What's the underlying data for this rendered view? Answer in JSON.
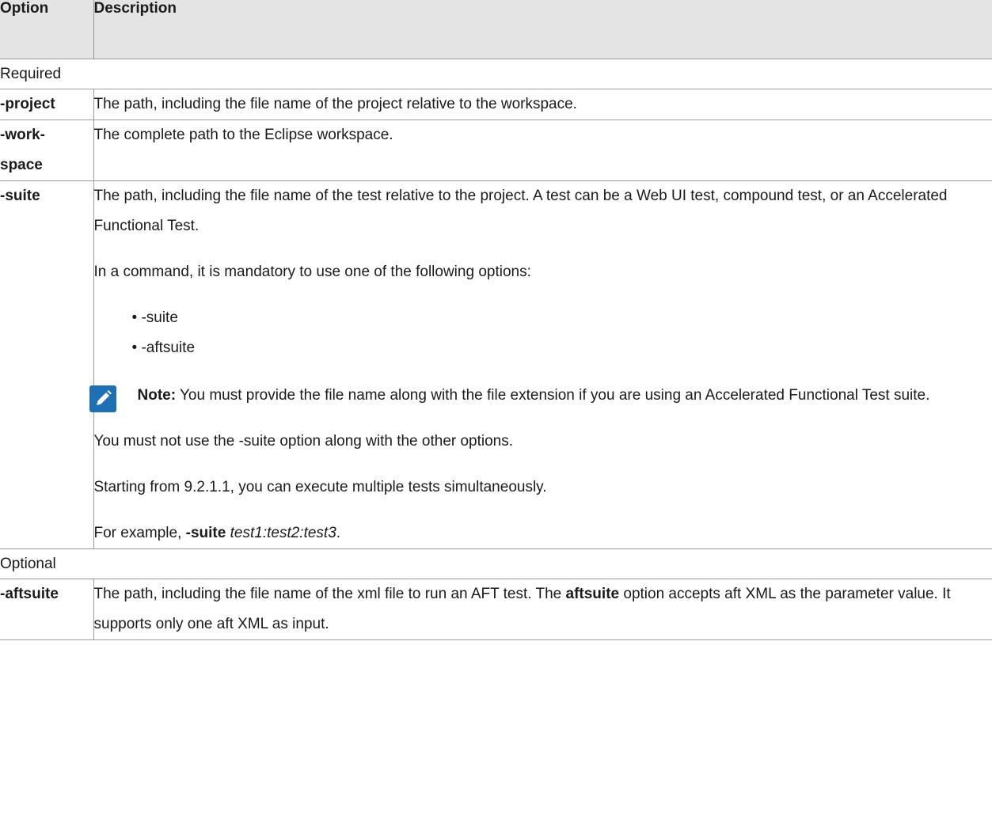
{
  "header": {
    "option": "Option",
    "description": "Description"
  },
  "groups": {
    "required": "Required",
    "optional": "Optional"
  },
  "rows": {
    "project": {
      "name": "-project",
      "desc": "The path, including the file name of the project relative to the workspace."
    },
    "workspace": {
      "name_line1": "-work-",
      "name_line2": "space",
      "desc": "The complete path to the Eclipse workspace."
    },
    "suite": {
      "name": "-suite",
      "p1": "The path, including the file name of the test relative to the project. A test can be a Web UI test, compound test, or an Accelerated Functional Test.",
      "p2": "In a command, it is mandatory to use one of the following options:",
      "list": [
        "-suite",
        "-aftsuite"
      ],
      "note_label": "Note:",
      "note_text": " You must provide the file name along with the file extension if you are using an Accelerated Functional Test suite.",
      "p3": "You must not use the -suite option along with the other options.",
      "p4": "Starting from 9.2.1.1, you can execute multiple tests simultaneously.",
      "example_prefix": "For example, ",
      "example_bold": "-suite",
      "example_italic": "test1:test2:test3",
      "example_suffix": "."
    },
    "aftsuite": {
      "name": "-aftsuite",
      "desc_a": "The path, including the file name of the xml file to run an AFT test. The ",
      "desc_bold": "aftsuite",
      "desc_b": " option accepts aft XML as the parameter value. It supports only one aft XML as input."
    }
  },
  "icons": {
    "note": "pencil-icon",
    "note_color": "#1f6fb5"
  }
}
